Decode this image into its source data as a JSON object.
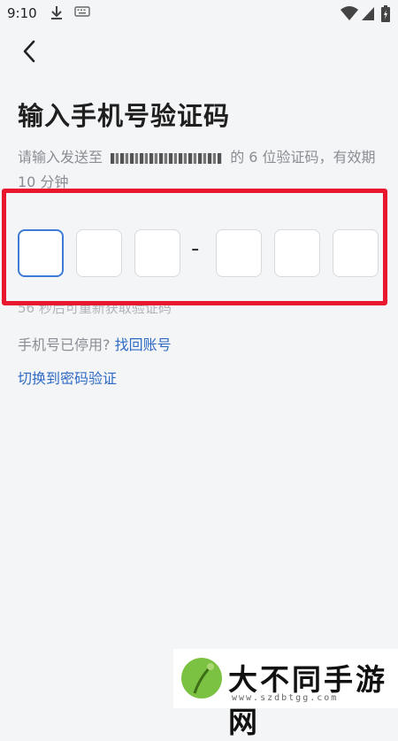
{
  "status_bar": {
    "time": "9:10",
    "icons": [
      "download-icon",
      "keyboard-icon",
      "wifi-icon",
      "signal-icon",
      "battery-icon"
    ]
  },
  "header": {
    "back_icon": "chevron-left-icon"
  },
  "main": {
    "title": "输入手机号验证码",
    "desc_prefix": "请输入发送至",
    "desc_suffix": "的 6 位验证码，有效期 10 分钟",
    "code_separator": "-",
    "resend_text": "56 秒后可重新获取验证码",
    "phone_stopped": "手机号已停用?",
    "recover_link": "找回账号",
    "switch_link": "切换到密码验证"
  },
  "colors": {
    "accent": "#3d7bd6",
    "link": "#2f6bc4",
    "highlight": "#e8172e"
  },
  "watermark": {
    "text": "大不同手游网",
    "url": "www.szdbtgg.com"
  }
}
